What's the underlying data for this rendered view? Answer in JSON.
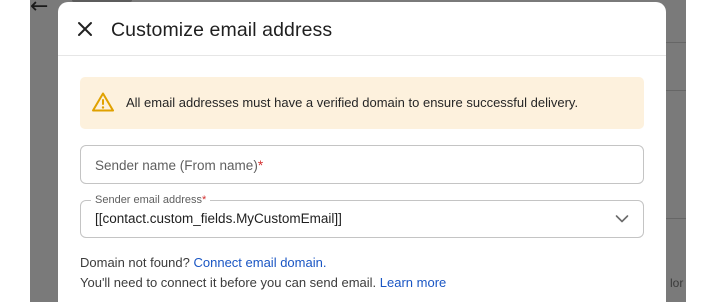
{
  "background": {
    "peek_text": "lor"
  },
  "dialog": {
    "title": "Customize email address",
    "close_label": "Close",
    "warning": {
      "icon": "warning-triangle-icon",
      "text": "All email addresses must have a verified domain to ensure successful delivery.",
      "color": "#fdf1dd"
    },
    "sender_name": {
      "placeholder": "Sender name (From name)",
      "required_mark": "*",
      "value": ""
    },
    "sender_email": {
      "label": "Sender email address",
      "required_mark": "*",
      "value": "[[contact.custom_fields.MyCustomEmail]]"
    },
    "help": {
      "line1_text": "Domain not found?",
      "line1_link": "Connect email domain.",
      "line2_text": "You'll need to connect it before you can send email.",
      "line2_link": "Learn more"
    }
  },
  "colors": {
    "link": "#1a56c4",
    "required": "#d32f2f",
    "warning_icon": "#e0a100"
  }
}
